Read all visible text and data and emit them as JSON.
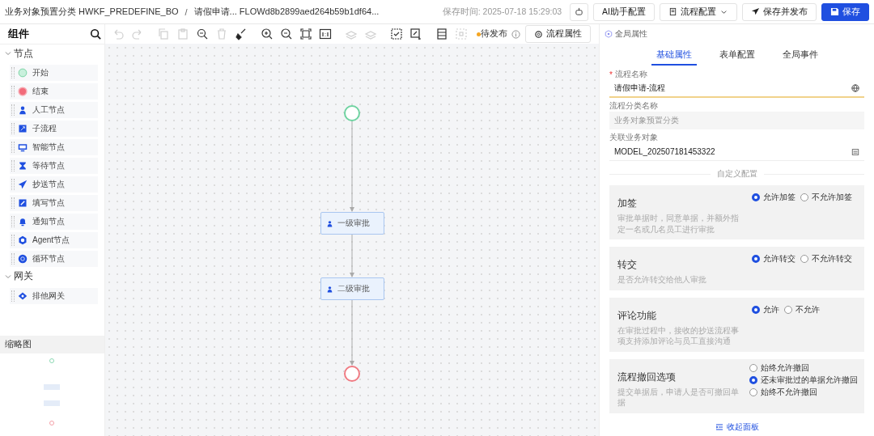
{
  "header": {
    "breadcrumb": [
      {
        "category": "业务对象预置分类",
        "code": "HWKF_PREDEFINE_BO"
      },
      {
        "category": "请假申请...",
        "code": "FLOWd8b2899aed264b59b1df64..."
      }
    ],
    "separator": "/",
    "save_time": "保存时间: 2025-07-18 15:29:03",
    "buttons": [
      {
        "kind": "icon"
      },
      {
        "kind": "plain",
        "label": "AI助手配置"
      },
      {
        "kind": "dropdown",
        "label": "流程配置"
      },
      {
        "kind": "publish",
        "label": "保存并发布"
      },
      {
        "kind": "primary",
        "label": "保存"
      }
    ]
  },
  "components": {
    "title": "组件",
    "sections": [
      {
        "title": "节点",
        "expanded": true,
        "items": [
          {
            "kind": "start",
            "label": "开始"
          },
          {
            "kind": "end",
            "label": "结束"
          },
          {
            "kind": "user",
            "label": "人工节点"
          },
          {
            "kind": "subflow",
            "label": "子流程"
          },
          {
            "kind": "smart",
            "label": "智能节点"
          },
          {
            "kind": "wait",
            "label": "等待节点"
          },
          {
            "kind": "send",
            "label": "抄送节点"
          },
          {
            "kind": "fill",
            "label": "填写节点"
          },
          {
            "kind": "bell",
            "label": "通知节点"
          },
          {
            "kind": "agent",
            "label": "Agent节点"
          },
          {
            "kind": "loop",
            "label": "循环节点"
          }
        ]
      },
      {
        "title": "网关",
        "expanded": true,
        "items": [
          {
            "kind": "gateway",
            "label": "排他网关"
          }
        ]
      }
    ]
  },
  "minimap": {
    "title": "缩略图"
  },
  "toolbar": {
    "tools": [
      {
        "kind": "undo",
        "disabled": true
      },
      {
        "kind": "redo",
        "disabled": true
      },
      {
        "kind": "copy",
        "disabled": true
      },
      {
        "kind": "paste",
        "disabled": true
      },
      {
        "kind": "zoom",
        "disabled": false
      },
      {
        "kind": "delete",
        "disabled": true
      },
      {
        "kind": "brush",
        "disabled": false
      },
      {
        "kind": "zoom-in",
        "disabled": false
      },
      {
        "kind": "zoom-out",
        "disabled": false
      },
      {
        "kind": "fit",
        "disabled": false
      },
      {
        "kind": "actual",
        "disabled": false
      },
      {
        "kind": "layer",
        "disabled": true
      },
      {
        "kind": "layer",
        "disabled": true
      },
      {
        "kind": "select",
        "disabled": false
      },
      {
        "kind": "node",
        "disabled": false
      },
      {
        "kind": "grid",
        "disabled": false
      },
      {
        "kind": "frame",
        "disabled": true
      }
    ],
    "status": {
      "label": "待发布",
      "color": "#f5a623"
    },
    "process_button": "流程属性",
    "global_tab": "全局属性"
  },
  "flow": {
    "nodes": [
      {
        "kind": "start"
      },
      {
        "kind": "task",
        "label": "一级审批"
      },
      {
        "kind": "task",
        "label": "二级审批"
      },
      {
        "kind": "end"
      }
    ]
  },
  "panel": {
    "tabs": [
      {
        "label": "基础属性",
        "selected": true
      },
      {
        "label": "表单配置",
        "selected": false
      },
      {
        "label": "全局事件",
        "selected": false
      }
    ],
    "fields": [
      {
        "marker": "*",
        "label": "流程名称",
        "value": "请假申请-流程",
        "kind": "lang",
        "disabled": false
      },
      {
        "label": "流程分类名称",
        "value": "业务对象预置分类",
        "kind": "text",
        "disabled": true
      },
      {
        "label": "关联业务对象",
        "value": "MODEL_202507181453322",
        "kind": "lookup",
        "disabled": false
      }
    ],
    "divider": "自定义配置",
    "cards": [
      {
        "title": "加签",
        "description": "审批单据时，同意单据，并额外指定一名或几名员工进行审批",
        "kind": "inline",
        "options": [
          {
            "label": "允许加签",
            "selected": true
          },
          {
            "label": "不允许加签",
            "selected": false
          }
        ]
      },
      {
        "title": "转交",
        "description": "是否允许转交给他人审批",
        "kind": "inline",
        "options": [
          {
            "label": "允许转交",
            "selected": true
          },
          {
            "label": "不允许转交",
            "selected": false
          }
        ]
      },
      {
        "title": "评论功能",
        "description": "在审批过程中，接收的抄送流程事项支持添加评论与员工直接沟通",
        "kind": "inline",
        "options": [
          {
            "label": "允许",
            "selected": true
          },
          {
            "label": "不允许",
            "selected": false
          }
        ]
      },
      {
        "title": "流程撤回选项",
        "description": "提交单据后，申请人是否可撤回单据",
        "kind": "stacked",
        "options": [
          {
            "label": "始终允许撤回",
            "selected": false
          },
          {
            "label": "还未审批过的单据允许撤回",
            "selected": true
          },
          {
            "label": "始终不允许撤回",
            "selected": false
          }
        ]
      }
    ],
    "collapse": "收起面板"
  }
}
